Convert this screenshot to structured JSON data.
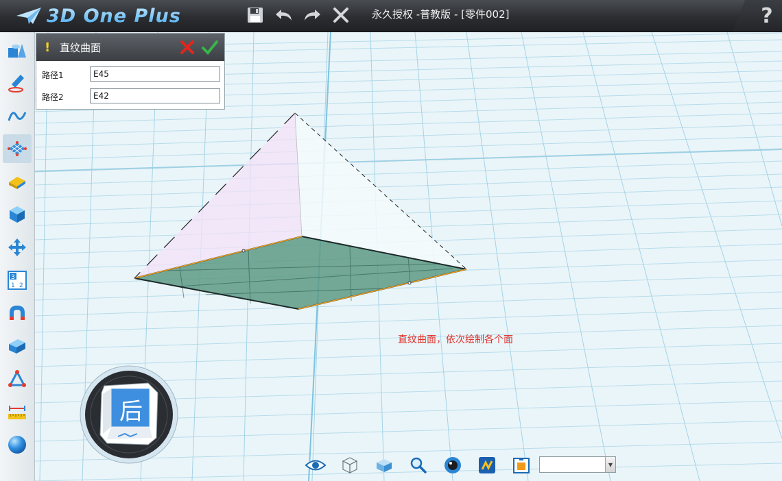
{
  "app": {
    "logo_text": "3D One Plus",
    "window_title": "永久授权 -普教版 - [零件002]",
    "help_label": "?"
  },
  "toolbar": {
    "items": [
      "save-icon",
      "undo-icon",
      "redo-icon",
      "delete-icon"
    ]
  },
  "sidebar": {
    "items": [
      "basic-solid-icon",
      "sketch-draw-icon",
      "curve-icon",
      "surface-icon",
      "special-function-icon",
      "feature-edit-icon",
      "move-icon",
      "pattern-icon",
      "adsorb-icon",
      "combine-icon",
      "distance-measure-icon",
      "measure-ruler-icon",
      "color-sphere-icon"
    ],
    "active_index": 3
  },
  "panel": {
    "title": "直纹曲面",
    "fields": [
      {
        "label": "路径1",
        "value": "E45"
      },
      {
        "label": "路径2",
        "value": "E42"
      }
    ]
  },
  "annotation": "直纹曲面，依次绘制各个面",
  "navcube": {
    "face_label": "后"
  },
  "bottom_toolbar": {
    "items": [
      "view-eye-icon",
      "wireframe-cube-icon",
      "shaded-cube-icon",
      "zoom-icon",
      "render-icon",
      "material-icon",
      "snapshot-icon"
    ],
    "combo_value": ""
  },
  "colors": {
    "accent": "#3b8fd8",
    "annotation": "#e0332b",
    "grid": "#8fcbe2",
    "face": "#5e9a85"
  }
}
